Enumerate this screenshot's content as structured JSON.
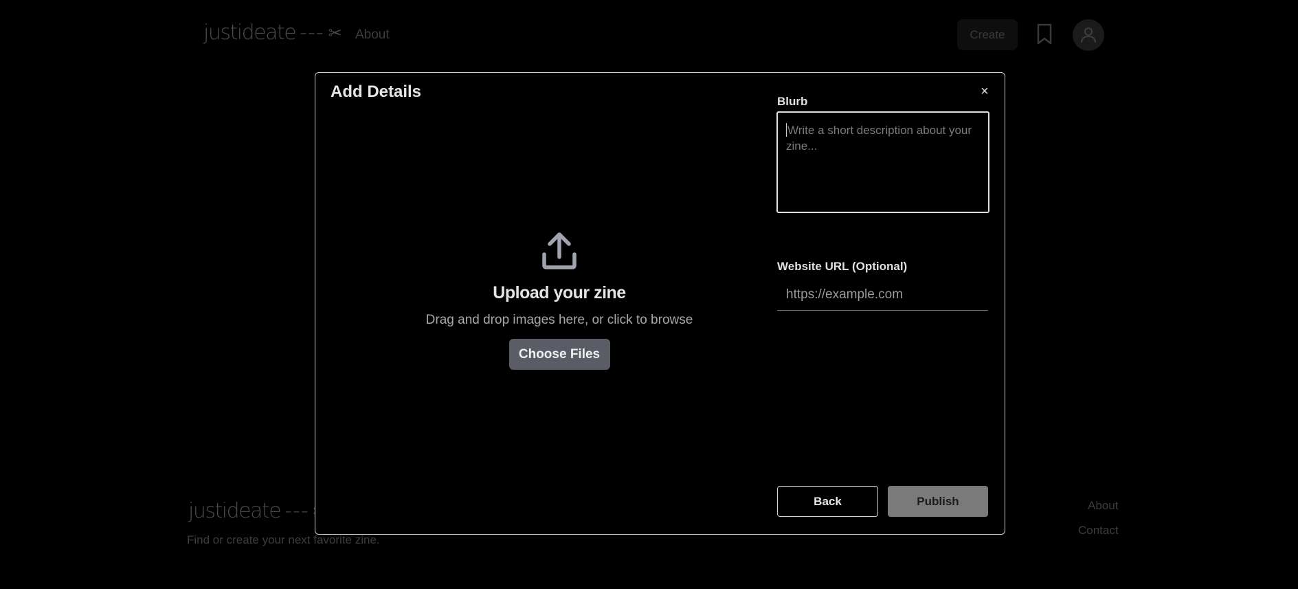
{
  "header": {
    "logo": {
      "word": "justideate",
      "dashes": "---",
      "scissor": "✂"
    },
    "nav_about": "About",
    "create_label": "Create",
    "bookmark_icon": "bookmark-icon",
    "avatar_icon": "user-icon"
  },
  "background": {
    "title": "",
    "text": "",
    "footer": {
      "logo": {
        "word": "justideate",
        "dashes": "---",
        "scissor": "✂"
      },
      "tagline": "Find or create your next favorite zine.",
      "about": "About",
      "contact": "Contact"
    }
  },
  "modal": {
    "title": "Add Details",
    "close_glyph": "×",
    "upload": {
      "icon": "upload-icon",
      "heading": "Upload your zine",
      "subtext": "Drag and drop images here, or click to browse",
      "button": "Choose Files"
    },
    "blurb": {
      "label": "Blurb",
      "placeholder": "Write a short description about your zine...",
      "value": ""
    },
    "website": {
      "label": "Website URL (Optional)",
      "placeholder": "https://example.com",
      "value": ""
    },
    "back_label": "Back",
    "publish_label": "Publish"
  },
  "colors": {
    "background": "#000000",
    "modal_border": "#cfcfcf",
    "choose_button": "#5a5c66",
    "publish_button": "#7a7a7a"
  }
}
